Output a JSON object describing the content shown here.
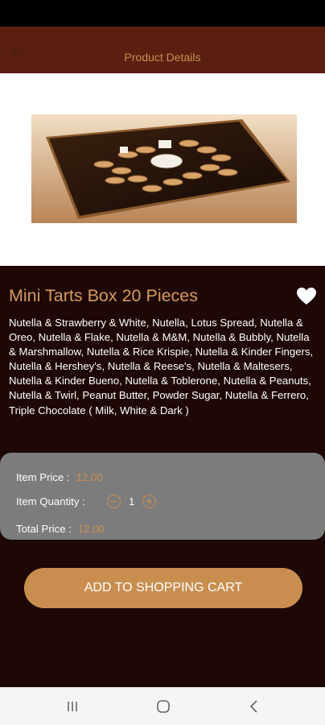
{
  "app_bar": {
    "title": "Product Details",
    "back_icon": "arrow-left-icon"
  },
  "product": {
    "name": "Mini Tarts Box 20 Pieces",
    "favorite_icon": "heart-icon",
    "description": "Nutella & Strawberry & White, Nutella, Lotus Spread, Nutella & Oreo, Nutella & Flake, Nutella & M&M, Nutella & Bubbly, Nutella & Marshmallow, Nutella & Rice Krispie, Nutella & Kinder Fingers, Nutella & Hershey's, Nutella & Reese's, Nutella & Maltesers, Nutella & Kinder Bueno, Nutella & Toblerone, Nutella & Peanuts, Nutella & Twirl, Peanut Butter, Powder Sugar, Nutella & Ferrero, Triple Chocolate ( Milk, White & Dark )"
  },
  "pricing": {
    "item_price_label": "Item Price :",
    "item_price_value": "12.00",
    "item_quantity_label": "Item Quantity :",
    "quantity": "1",
    "decrement_icon": "minus-circle-icon",
    "increment_icon": "plus-circle-icon",
    "total_price_label": "Total Price :",
    "total_price_value": "12.00"
  },
  "cart_button_label": "ADD TO SHOPPING CART",
  "colors": {
    "app_bar": "#5a1f11",
    "background": "#1d0806",
    "accent": "#c98e4f",
    "price_card": "#7c7c7c"
  },
  "nav": {
    "recents_icon": "recents-icon",
    "home_icon": "home-icon",
    "back_icon": "back-chevron-icon"
  }
}
